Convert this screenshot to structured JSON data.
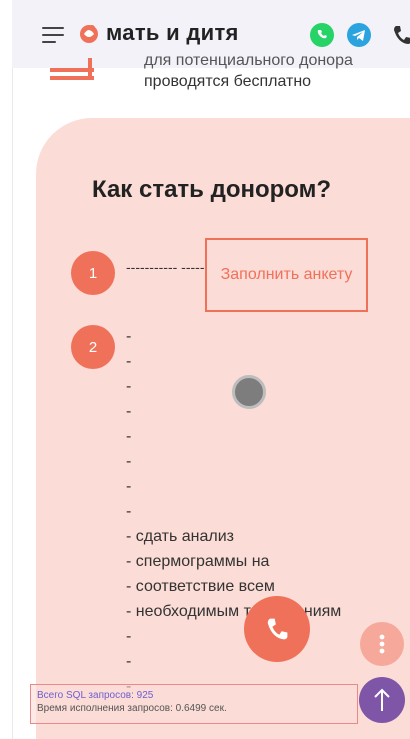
{
  "header": {
    "logo_text": "мать и дитя",
    "icons": [
      "menu-icon",
      "whatsapp-icon",
      "telegram-icon",
      "phone-icon"
    ],
    "colors": {
      "brand": "#f0715a",
      "whatsapp": "#25d366",
      "telegram": "#2aa3df"
    }
  },
  "intro": {
    "line1": "для потенциального донора",
    "line2": "проводятся бесплатно"
  },
  "how_to": {
    "title": "Как стать донором?",
    "step1": {
      "number": "1",
      "text": "----------- -----",
      "button_label": "Заполнить анкету"
    },
    "step2": {
      "number": "2",
      "items": [
        "-",
        "-",
        "-",
        "-",
        "-",
        "-",
        "-",
        "-",
        "- сдать анализ",
        "- спермограммы на",
        "- соответствие всем",
        "- необходимым требованиям",
        "-",
        "-",
        "-"
      ]
    }
  },
  "floating": {
    "call_icon": "phone-icon",
    "more_icon": "more-vertical-icon",
    "top_icon": "arrow-up-icon"
  },
  "debug": {
    "sql_queries": "Всего SQL запросов: 925",
    "exec_time": "Время исполнения запросов: 0.6499 сек."
  }
}
